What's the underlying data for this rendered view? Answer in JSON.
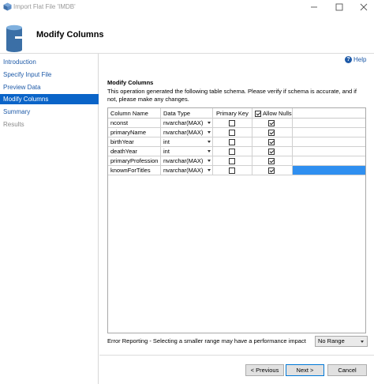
{
  "window": {
    "title": "Import Flat File 'IMDB'"
  },
  "header": {
    "title": "Modify Columns"
  },
  "sidebar": {
    "items": [
      {
        "label": "Introduction",
        "state": "link"
      },
      {
        "label": "Specify Input File",
        "state": "link"
      },
      {
        "label": "Preview Data",
        "state": "link"
      },
      {
        "label": "Modify Columns",
        "state": "active"
      },
      {
        "label": "Summary",
        "state": "link"
      },
      {
        "label": "Results",
        "state": "disabled"
      }
    ]
  },
  "help": {
    "label": "Help"
  },
  "section": {
    "title": "Modify Columns",
    "description": "This operation generated the following table schema. Please verify if schema is accurate, and if not, please make any changes."
  },
  "grid": {
    "headers": {
      "column_name": "Column Name",
      "data_type": "Data Type",
      "primary_key": "Primary Key",
      "allow_nulls": "Allow Nulls"
    },
    "allow_nulls_header_checked": true,
    "rows": [
      {
        "name": "nconst",
        "type": "nvarchar(MAX)",
        "primary_key": false,
        "allow_nulls": true
      },
      {
        "name": "primaryName",
        "type": "nvarchar(MAX)",
        "primary_key": false,
        "allow_nulls": true
      },
      {
        "name": "birthYear",
        "type": "int",
        "primary_key": false,
        "allow_nulls": true
      },
      {
        "name": "deathYear",
        "type": "int",
        "primary_key": false,
        "allow_nulls": true
      },
      {
        "name": "primaryProfession",
        "type": "nvarchar(MAX)",
        "primary_key": false,
        "allow_nulls": true
      },
      {
        "name": "knownForTitles",
        "type": "nvarchar(MAX)",
        "primary_key": false,
        "allow_nulls": true
      }
    ]
  },
  "error_reporting": {
    "label": "Error Reporting - Selecting a smaller range may have a performance impact",
    "selected": "No Range"
  },
  "buttons": {
    "previous": "< Previous",
    "next": "Next >",
    "cancel": "Cancel"
  },
  "colors": {
    "accent": "#0a64c8",
    "link": "#1e5aa8",
    "selection": "#2f8ff0"
  }
}
